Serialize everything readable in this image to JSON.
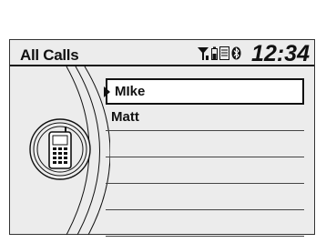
{
  "screen": {
    "title": "All Calls",
    "clock": "12:34"
  },
  "status_icons": [
    "signal-icon",
    "battery-icon",
    "roaming-icon",
    "bluetooth-icon"
  ],
  "call_list": {
    "items": [
      {
        "label": "MIke",
        "selected": true
      },
      {
        "label": "Matt",
        "selected": false
      },
      {
        "label": "",
        "selected": false
      },
      {
        "label": "",
        "selected": false
      },
      {
        "label": "",
        "selected": false
      },
      {
        "label": "",
        "selected": false
      }
    ]
  },
  "colors": {
    "screen_bg": "#ececec",
    "text": "#111111",
    "selection_bg": "#ffffff"
  }
}
